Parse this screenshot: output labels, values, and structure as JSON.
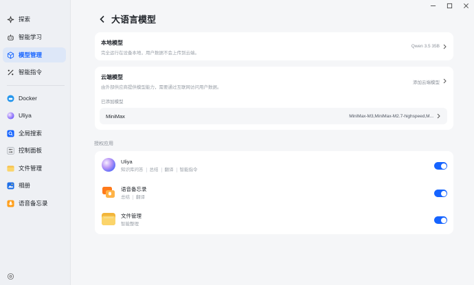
{
  "sidebar": {
    "items": [
      {
        "label": "探索",
        "icon": "sparkle-icon"
      },
      {
        "label": "智能学习",
        "icon": "robot-icon"
      },
      {
        "label": "模型管理",
        "icon": "cube-icon",
        "active": true
      },
      {
        "label": "智能指令",
        "icon": "command-icon"
      },
      {
        "label": "Docker",
        "icon": "docker-icon"
      },
      {
        "label": "Uliya",
        "icon": "uliya-icon"
      },
      {
        "label": "全局搜索",
        "icon": "search-icon"
      },
      {
        "label": "控制面板",
        "icon": "control-panel-icon"
      },
      {
        "label": "文件管理",
        "icon": "folder-icon"
      },
      {
        "label": "相册",
        "icon": "photo-icon"
      },
      {
        "label": "语音备忘录",
        "icon": "voice-memo-icon"
      }
    ]
  },
  "header": {
    "title": "大语言模型"
  },
  "local_model": {
    "title": "本地模型",
    "desc": "完全运行在设备本地，用户数据不会上传到云端。",
    "value": "Qwen 3.5 35B"
  },
  "cloud_model": {
    "title": "云端模型",
    "desc": "由外部供应商提供模型能力，需要通过互联网访问用户数据。",
    "action": "添加云端模型",
    "added_label": "已添加模型",
    "provider": "MiniMax",
    "provider_models": "MiniMax-M3,MiniMax-M2.7-highspeed,M..."
  },
  "auth_apps": {
    "label": "授权应用",
    "apps": [
      {
        "name": "Uliya",
        "tags": [
          "知识库问答",
          "总结",
          "翻译",
          "智能指令"
        ],
        "enabled": true
      },
      {
        "name": "语音备忘录",
        "tags": [
          "总结",
          "翻译"
        ],
        "enabled": true
      },
      {
        "name": "文件管理",
        "tags": [
          "智能整理"
        ],
        "enabled": true
      }
    ]
  },
  "colors": {
    "accent": "#1664ff",
    "sidebar_bg": "#eef0f4",
    "main_bg": "#f5f6f8"
  }
}
